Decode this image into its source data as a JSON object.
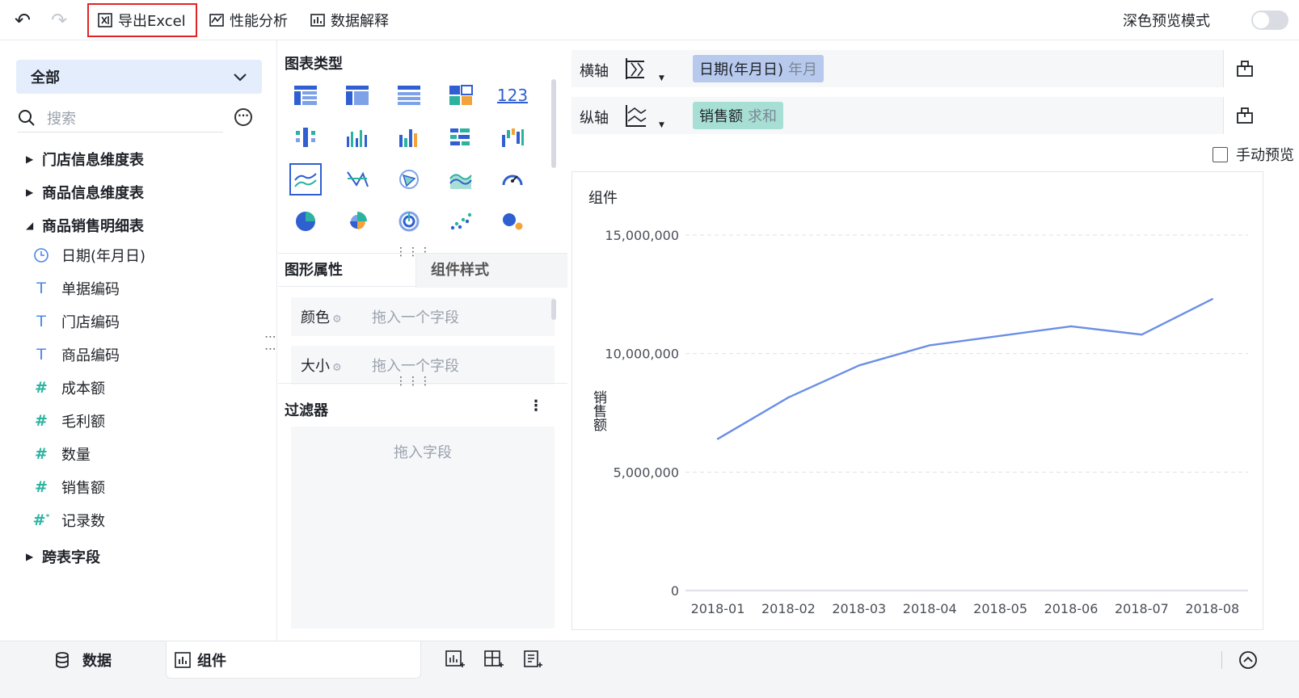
{
  "toolbar": {
    "undo_icon": "undo-icon",
    "redo_icon": "redo-icon",
    "export_label": "导出Excel",
    "perf_label": "性能分析",
    "explain_label": "数据解释",
    "dark_mode_label": "深色预览模式",
    "dark_mode_on": false
  },
  "left": {
    "select_value": "全部",
    "search_placeholder": "搜索",
    "groups": [
      {
        "label": "门店信息维度表",
        "expanded": false
      },
      {
        "label": "商品信息维度表",
        "expanded": false
      },
      {
        "label": "商品销售明细表",
        "expanded": true
      }
    ],
    "fields": [
      {
        "label": "日期(年月日)",
        "type": "date"
      },
      {
        "label": "单据编码",
        "type": "text"
      },
      {
        "label": "门店编码",
        "type": "text"
      },
      {
        "label": "商品编码",
        "type": "text"
      },
      {
        "label": "成本额",
        "type": "number"
      },
      {
        "label": "毛利额",
        "type": "number"
      },
      {
        "label": "数量",
        "type": "number"
      },
      {
        "label": "销售额",
        "type": "number"
      },
      {
        "label": "记录数",
        "type": "calc-number"
      }
    ],
    "cross_table": "跨表字段"
  },
  "middle": {
    "chart_type_title": "图表类型",
    "number_card_label": "123",
    "tab_props": "图形属性",
    "tab_style": "组件样式",
    "color_label": "颜色",
    "size_label": "大小",
    "drop_placeholder": "拖入一个字段",
    "filter_title": "过滤器",
    "filter_placeholder": "拖入字段"
  },
  "right": {
    "x_axis_label": "横轴",
    "x_field": "日期(年月日)",
    "x_field_sub": "年月",
    "y_axis_label": "纵轴",
    "y_field": "销售额",
    "y_field_sub": "求和",
    "manual_preview": "手动预览",
    "chart_title": "组件"
  },
  "bottom": {
    "data_tab": "数据",
    "component_tab": "组件"
  },
  "chart_data": {
    "type": "line",
    "title": "组件",
    "ylabel": "销售额",
    "xlabel": "",
    "categories": [
      "2018-01",
      "2018-02",
      "2018-03",
      "2018-04",
      "2018-05",
      "2018-06",
      "2018-07",
      "2018-08"
    ],
    "series": [
      {
        "name": "销售额",
        "values": [
          6400000,
          8150000,
          9500000,
          10350000,
          10750000,
          11150000,
          10800000,
          12300000
        ],
        "color": "#6b8fe6"
      }
    ],
    "ylim": [
      0,
      15000000
    ],
    "yticks": [
      0,
      5000000,
      10000000,
      15000000
    ],
    "ytick_labels": [
      "0",
      "5,000,000",
      "10,000,000",
      "15,000,000"
    ],
    "grid": true
  }
}
